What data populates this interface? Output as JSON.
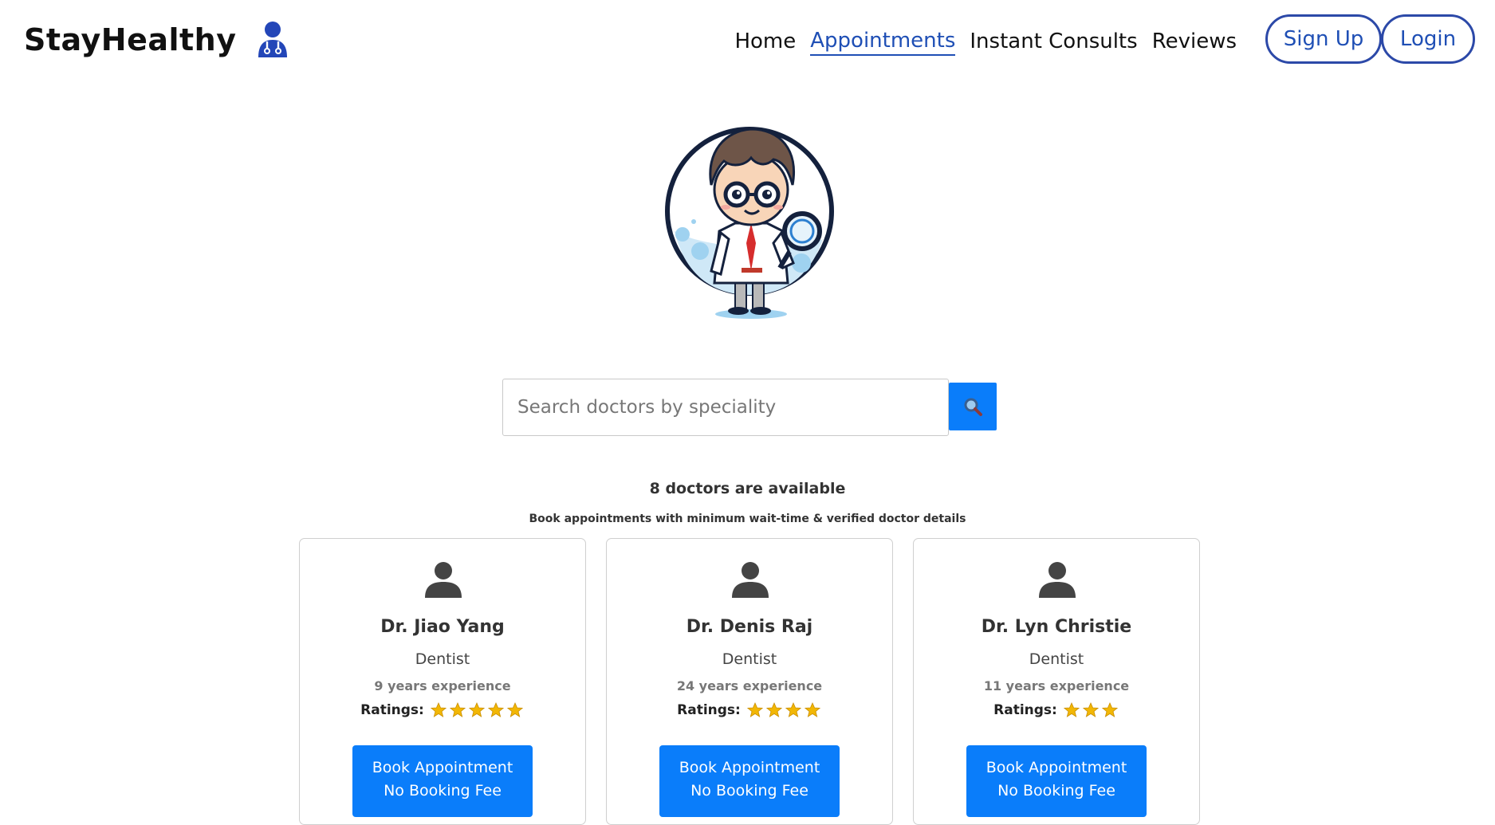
{
  "brand": {
    "name": "StayHealthy",
    "icon": "doctor-person-icon"
  },
  "nav": {
    "links": [
      "Home",
      "Appointments",
      "Instant Consults",
      "Reviews"
    ],
    "active": "Appointments",
    "signup": "Sign Up",
    "login": "Login"
  },
  "hero": {
    "image": "cartoon-doctor-magnifying-glass"
  },
  "search": {
    "placeholder": "Search doctors by speciality",
    "button_icon": "magnifier-icon"
  },
  "availability": {
    "title": "8 doctors are available",
    "subtitle": "Book appointments with minimum wait-time & verified doctor details"
  },
  "doctors": [
    {
      "name": "Dr. Jiao Yang",
      "speciality": "Dentist",
      "experience": "9 years experience",
      "rating": 5
    },
    {
      "name": "Dr. Denis Raj",
      "speciality": "Dentist",
      "experience": "24 years experience",
      "rating": 4
    },
    {
      "name": "Dr. Lyn Christie",
      "speciality": "Dentist",
      "experience": "11 years experience",
      "rating": 3
    }
  ],
  "card": {
    "ratings_label": "Ratings:",
    "book_line1": "Book Appointment",
    "book_line2": "No Booking Fee"
  },
  "colors": {
    "accent": "#0a7dfa",
    "nav_blue": "#1f4fb5",
    "star": "#f2b705"
  }
}
